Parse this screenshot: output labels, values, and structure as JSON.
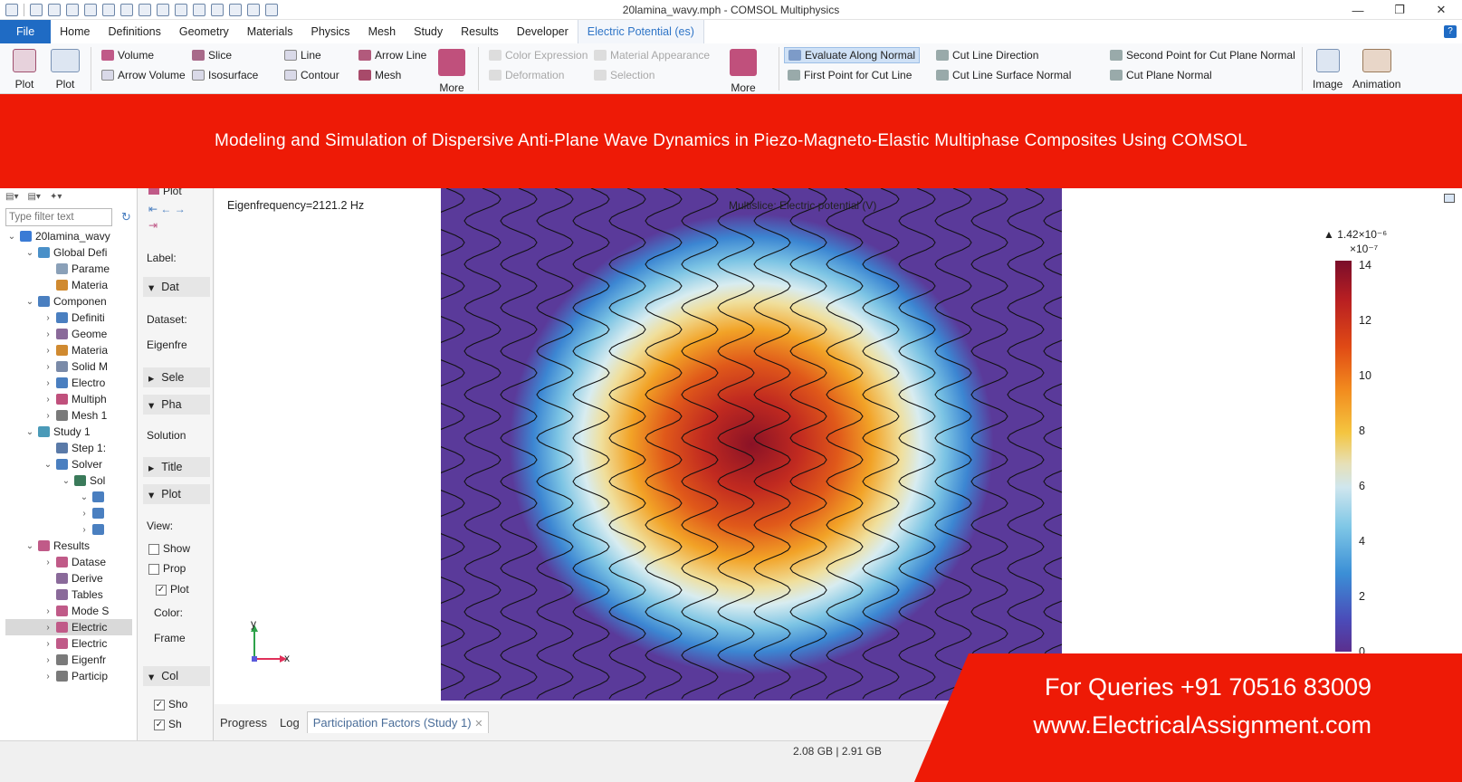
{
  "window": {
    "title": "20lamina_wavy.mph - COMSOL Multiphysics",
    "controls": [
      "—",
      "❐",
      "✕"
    ]
  },
  "menu": {
    "tabs": [
      "File",
      "Home",
      "Definitions",
      "Geometry",
      "Materials",
      "Physics",
      "Mesh",
      "Study",
      "Results",
      "Developer",
      "Electric Potential (es)"
    ],
    "help": "?"
  },
  "ribbon": {
    "plot1": "Plot",
    "plot2": "Plot",
    "group1": [
      "Volume",
      "Slice",
      "Line",
      "Arrow Line",
      "Arrow Volume",
      "Isosurface",
      "Contour",
      "Mesh"
    ],
    "more1": "More",
    "group2": [
      "Color Expression",
      "Material Appearance",
      "Deformation",
      "Selection"
    ],
    "more2": "More",
    "group3": [
      "Evaluate Along Normal",
      "Cut Line Direction",
      "Second Point for Cut Plane Normal",
      "First Point for Cut Line",
      "Cut Line Surface Normal",
      "Cut Plane Normal"
    ],
    "image": "Image",
    "animation": "Animation"
  },
  "banner": {
    "text": "Modeling and Simulation of Dispersive Anti-Plane Wave Dynamics in Piezo-Magneto-Elastic Multiphase Composites Using COMSOL"
  },
  "tree": {
    "filter_placeholder": "Type filter text",
    "nodes": [
      {
        "label": "20lamina_wavy",
        "level": 0,
        "arrow": "v"
      },
      {
        "label": "Global Defi",
        "level": 1,
        "arrow": "v"
      },
      {
        "label": "Parame",
        "level": 2,
        "arrow": ""
      },
      {
        "label": "Materia",
        "level": 2,
        "arrow": ""
      },
      {
        "label": "Componen",
        "level": 1,
        "arrow": "v"
      },
      {
        "label": "Definiti",
        "level": 2,
        "arrow": ">"
      },
      {
        "label": "Geome",
        "level": 2,
        "arrow": ">"
      },
      {
        "label": "Materia",
        "level": 2,
        "arrow": ">"
      },
      {
        "label": "Solid M",
        "level": 2,
        "arrow": ">"
      },
      {
        "label": "Electro",
        "level": 2,
        "arrow": ">"
      },
      {
        "label": "Multiph",
        "level": 2,
        "arrow": ">"
      },
      {
        "label": "Mesh 1",
        "level": 2,
        "arrow": ">"
      },
      {
        "label": "Study 1",
        "level": 1,
        "arrow": "v"
      },
      {
        "label": "Step 1:",
        "level": 2,
        "arrow": ""
      },
      {
        "label": "Solver",
        "level": 2,
        "arrow": "v"
      },
      {
        "label": "Sol",
        "level": 3,
        "arrow": "v"
      },
      {
        "label": "",
        "level": 4,
        "arrow": "v"
      },
      {
        "label": "",
        "level": 4,
        "arrow": ">"
      },
      {
        "label": "",
        "level": 4,
        "arrow": ">"
      },
      {
        "label": "Results",
        "level": 1,
        "arrow": "v"
      },
      {
        "label": "Datase",
        "level": 2,
        "arrow": ">"
      },
      {
        "label": "Derive",
        "level": 2,
        "arrow": ""
      },
      {
        "label": "Tables",
        "level": 2,
        "arrow": ""
      },
      {
        "label": "Mode S",
        "level": 2,
        "arrow": ">"
      },
      {
        "label": "Electric",
        "level": 2,
        "arrow": ">"
      },
      {
        "label": "Electric",
        "level": 2,
        "arrow": ">"
      },
      {
        "label": "Eigenfr",
        "level": 2,
        "arrow": ">"
      },
      {
        "label": "Particip",
        "level": 2,
        "arrow": ">"
      }
    ]
  },
  "settings": {
    "plot": "Plot",
    "label": "Label:",
    "sec_data": "Dat",
    "dataset": "Dataset:",
    "eigenfreq": "Eigenfre",
    "sec_sel": "Sele",
    "sec_phase": "Pha",
    "solution": "Solution",
    "sec_title": "Title",
    "sec_plot": "Plot",
    "view": "View:",
    "show": "Show",
    "prop": "Prop",
    "plot_chk": "Plot",
    "color": "Color:",
    "frame": "Frame",
    "sec_col": "Col",
    "sho": "Sho",
    "sh": "Sh"
  },
  "graphics": {
    "eigenfrequency": "Eigenfrequency=2121.2 Hz",
    "plot_title": "Multislice: Electric potential (V)",
    "axis_y": "y",
    "axis_x": "x",
    "colorbar_max": "▲ 1.42×10⁻⁶",
    "colorbar_exp": "×10⁻⁷",
    "colorbar_ticks": [
      "14",
      "12",
      "10",
      "8",
      "6",
      "4",
      "2",
      "0"
    ]
  },
  "bottom_tabs": [
    "Progress",
    "Log",
    "Participation Factors (Study 1)"
  ],
  "close_tab": "✕",
  "status": "2.08 GB | 2.91 GB",
  "contact": {
    "line1": "For Queries +91 70516 83009",
    "line2": "www.ElectricalAssignment.com"
  }
}
